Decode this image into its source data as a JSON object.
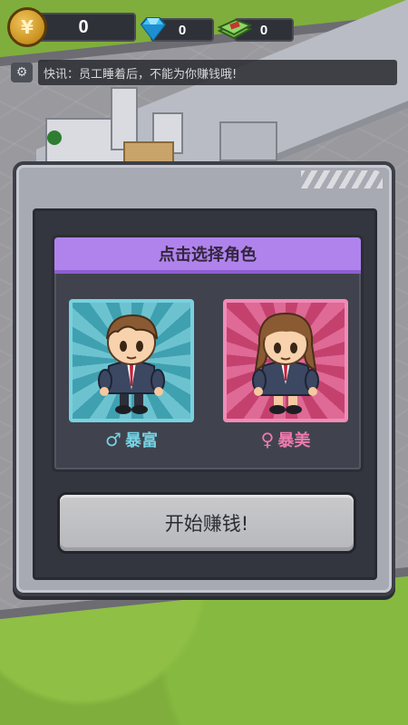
{
  "topbar": {
    "coins": "0",
    "coin_symbol": "¥",
    "gems": "0",
    "cash": "0"
  },
  "ticker": {
    "text": "快讯：员工睡着后，不能为你赚钱哦!"
  },
  "modal": {
    "header": "点击选择角色",
    "characters": [
      {
        "label": "暴富",
        "symbol": "♂",
        "accent": "#75d3e4"
      },
      {
        "label": "暴美",
        "symbol": "♀",
        "accent": "#f07ab0"
      }
    ],
    "start_button": "开始赚钱!"
  },
  "colors": {
    "header_purple": "#b083ec",
    "male_teal": "#3fa0b0",
    "female_pink": "#c4416e"
  }
}
